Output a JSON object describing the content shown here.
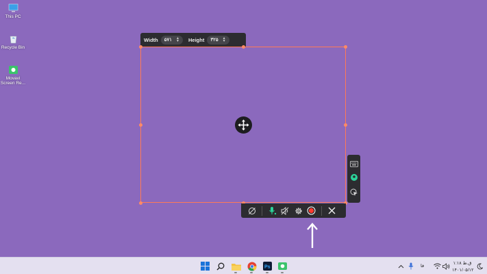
{
  "desktop": {
    "icons": [
      {
        "label": "This PC",
        "icon": "monitor-icon"
      },
      {
        "label": "Recycle Bin",
        "icon": "recycle-bin-icon"
      },
      {
        "label": "Movavi\nScreen Re...",
        "icon": "movavi-screen-recorder-icon"
      }
    ]
  },
  "size_toolbar": {
    "width_label": "Width",
    "width_value": "۵۷۱",
    "height_label": "Height",
    "height_value": "۳۲۵"
  },
  "capture_region": {
    "move_icon": "move-arrows-icon"
  },
  "side_toolbar": {
    "items": [
      "keyboard-icon",
      "webcam-icon",
      "cursor-click-icon"
    ]
  },
  "control_bar": {
    "items": [
      "webcam-off-icon",
      "microphone-icon",
      "speaker-muted-icon",
      "settings-icon",
      "record-icon",
      "close-icon"
    ],
    "accent": "#2bd49a",
    "record_color": "#ff3b30"
  },
  "taskbar": {
    "apps": [
      "windows-start-icon",
      "search-icon",
      "file-explorer-icon",
      "chrome-icon",
      "photoshop-icon",
      "movavi-icon"
    ],
    "tray": {
      "language": "فا",
      "time": "۱:۱۸ ق.ظ",
      "date": "۱۴۰۱/۰۵/۱۲"
    }
  },
  "colors": {
    "desktop_bg": "#8b69bd",
    "region_border": "#ff7a56",
    "toolbar_bg": "#2c2c30"
  }
}
